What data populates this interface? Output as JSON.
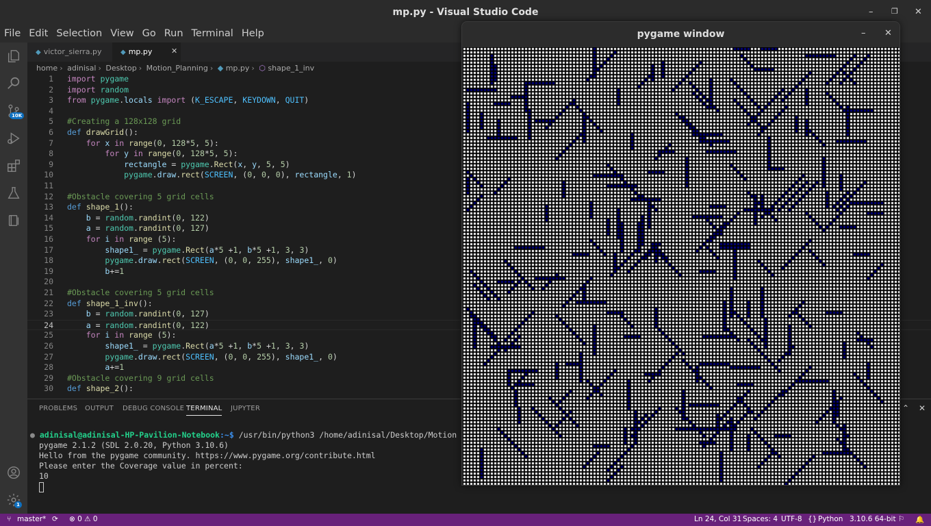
{
  "titlebar": {
    "title": "mp.py - Visual Studio Code",
    "minimize": "–",
    "maximize": "❐",
    "close": "✕"
  },
  "menu": [
    "File",
    "Edit",
    "Selection",
    "View",
    "Go",
    "Run",
    "Terminal",
    "Help"
  ],
  "activity": {
    "badge_scm": "10K",
    "badge_settings": "1"
  },
  "tabs": [
    {
      "label": "victor_sierra.py",
      "active": false
    },
    {
      "label": "mp.py",
      "active": true,
      "close": "✕"
    }
  ],
  "breadcrumb": [
    "home",
    "adinisal",
    "Desktop",
    "Motion_Planning",
    "mp.py",
    "shape_1_inv"
  ],
  "editor": {
    "current_line": 24,
    "lines": [
      "import pygame",
      "import random",
      "from pygame.locals import (K_ESCAPE, KEYDOWN, QUIT)",
      "",
      "#Creating a 128x128 grid",
      "def drawGrid():",
      "    for x in range(0, 128*5, 5):",
      "        for y in range(0, 128*5, 5):",
      "            rectangle = pygame.Rect(x, y, 5, 5)",
      "            pygame.draw.rect(SCREEN, (0, 0, 0), rectangle, 1)",
      "",
      "#Obstacle covering 5 grid cells",
      "def shape_1():",
      "    b = random.randint(0, 122)",
      "    a = random.randint(0, 127)",
      "    for i in range (5):",
      "        shape1_ = pygame.Rect(a*5 +1, b*5 +1, 3, 3)",
      "        pygame.draw.rect(SCREEN, (0, 0, 255), shape1_, 0)",
      "        b+=1",
      "",
      "#Obstacle covering 5 grid cells",
      "def shape_1_inv():",
      "    b = random.randint(0, 127)",
      "    a = random.randint(0, 122)",
      "    for i in range (5):",
      "        shape1_ = pygame.Rect(a*5 +1, b*5 +1, 3, 3)",
      "        pygame.draw.rect(SCREEN, (0, 0, 255), shape1_, 0)",
      "        a+=1",
      "#Obstacle covering 9 grid cells",
      "def shape_2():"
    ]
  },
  "panel": {
    "tabs": [
      "PROBLEMS",
      "OUTPUT",
      "DEBUG CONSOLE",
      "TERMINAL",
      "JUPYTER"
    ],
    "active_tab": "TERMINAL",
    "terminal": {
      "prompt_user": "adinisal@adinisal-HP-Pavilion-Notebook",
      "prompt_path": ":~$",
      "command": " /usr/bin/python3 /home/adinisal/Desktop/Motion",
      "output": [
        "pygame 2.1.2 (SDL 2.0.20, Python 3.10.6)",
        "Hello from the pygame community. https://www.pygame.org/contribute.html",
        "Please enter the Coverage value in percent:",
        "10"
      ]
    }
  },
  "status": {
    "branch": "master*",
    "problems": "⊗ 0 ⚠ 0",
    "position": "Ln 24, Col 31",
    "spaces": "Spaces: 4",
    "encoding": "UTF-8",
    "language": "Python",
    "interpreter": "3.10.6 64-bit"
  },
  "pygame": {
    "title": "pygame window",
    "minimize": "–",
    "close": "✕",
    "grid_cells": 128,
    "grid_color": "#000000",
    "obstacle_color": "#000080",
    "coverage_percent": 10
  }
}
